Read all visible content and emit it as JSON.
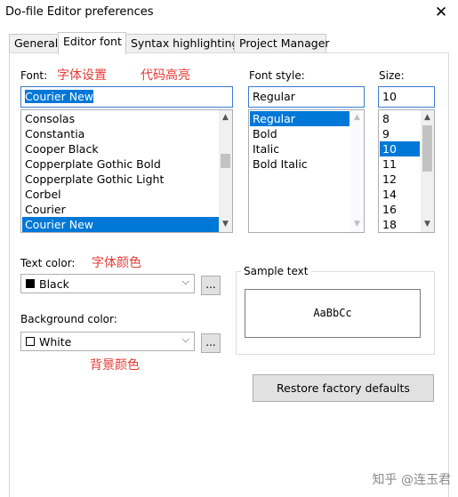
{
  "window": {
    "title": "Do-file Editor preferences",
    "close_glyph": "✕"
  },
  "tabs": [
    {
      "label": "General",
      "active": false
    },
    {
      "label": "Editor font",
      "active": true
    },
    {
      "label": "Syntax highlighting",
      "active": false
    },
    {
      "label": "Project Manager",
      "active": false
    }
  ],
  "font": {
    "label": "Font:",
    "value": "Courier New",
    "items": [
      "Consolas",
      "Constantia",
      "Cooper Black",
      "Copperplate Gothic Bold",
      "Copperplate Gothic Light",
      "Corbel",
      "Courier",
      "Courier New"
    ],
    "selected": "Courier New"
  },
  "font_style": {
    "label": "Font style:",
    "value": "Regular",
    "items": [
      "Regular",
      "Bold",
      "Italic",
      "Bold Italic"
    ],
    "selected": "Regular"
  },
  "size": {
    "label": "Size:",
    "value": "10",
    "items": [
      "8",
      "9",
      "10",
      "11",
      "12",
      "14",
      "16",
      "18"
    ],
    "selected": "10"
  },
  "annotations": {
    "font_setting": "字体设置",
    "code_highlight": "代码高亮",
    "text_color": "字体颜色",
    "background_color": "背景颜色"
  },
  "text_color": {
    "label": "Text color:",
    "value": "Black",
    "swatch": "#000000",
    "more": "..."
  },
  "background_color": {
    "label": "Background color:",
    "value": "White",
    "swatch": "#ffffff",
    "more": "..."
  },
  "sample": {
    "title": "Sample text",
    "text": "AaBbCc"
  },
  "restore_button": "Restore factory defaults",
  "watermark": "知乎 @连玉君",
  "colors": {
    "accent": "#0078d7",
    "annotation": "#e53935"
  }
}
